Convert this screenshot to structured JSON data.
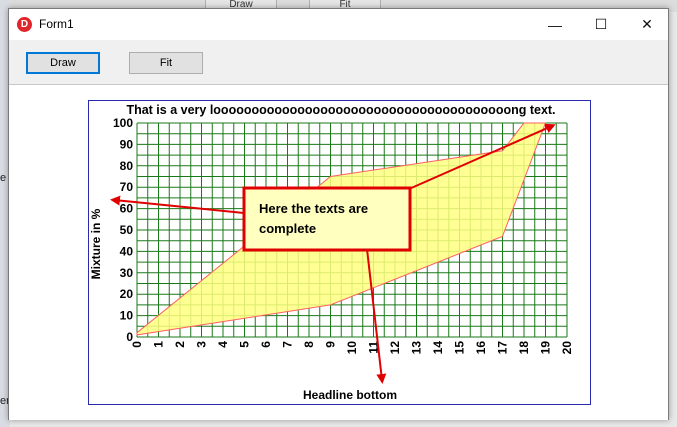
{
  "background": {
    "tab1": "Draw",
    "tab2": "Fit",
    "left_fragment_1": "e",
    "left_fragment_2": "er"
  },
  "window": {
    "title": "Form1",
    "icon_letter": "D",
    "minimize_glyph": "—",
    "maximize_glyph": "☐",
    "close_glyph": "✕"
  },
  "toolbar": {
    "draw_label": "Draw",
    "fit_label": "Fit"
  },
  "chart_data": {
    "type": "area",
    "title": "That is a very looooooooooooooooooooooooooooooooooooooong text.",
    "xlabel": "Headline bottom",
    "ylabel": "Mixture in %",
    "xlim": [
      0,
      20
    ],
    "ylim": [
      0,
      100
    ],
    "xticks": [
      0,
      1,
      2,
      3,
      4,
      5,
      6,
      7,
      8,
      9,
      10,
      11,
      12,
      13,
      14,
      15,
      16,
      17,
      18,
      19,
      20
    ],
    "yticks": [
      0,
      10,
      20,
      30,
      40,
      50,
      60,
      70,
      80,
      90,
      100
    ],
    "grid": true,
    "grid_color": "#1a7a1a",
    "fill_color": "#ffff80",
    "edge_color": "#ff6060",
    "polygon": [
      [
        0,
        2
      ],
      [
        9,
        75
      ],
      [
        17,
        87
      ],
      [
        18,
        100
      ],
      [
        19,
        100
      ],
      [
        17,
        47
      ],
      [
        9,
        15
      ],
      [
        0,
        1
      ]
    ],
    "annotation": {
      "text_line1": "Here the texts are",
      "text_line2": "complete",
      "box_color": "#ffffc0",
      "border_color": "#e00000"
    }
  }
}
